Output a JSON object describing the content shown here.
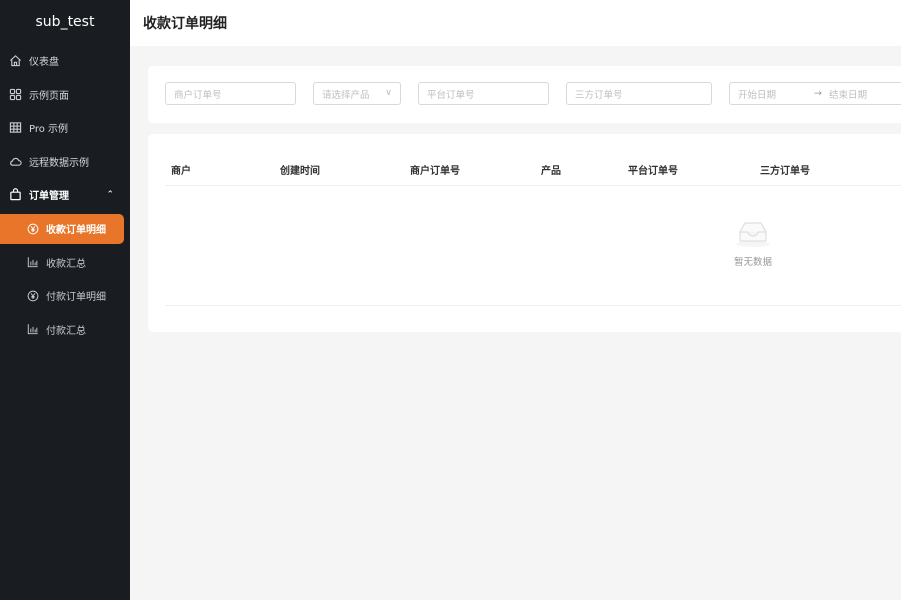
{
  "brand": {
    "title": "sub_test"
  },
  "sidebar": {
    "items": [
      {
        "label": "仪表盘",
        "icon": "home-icon"
      },
      {
        "label": "示例页面",
        "icon": "grid-icon"
      },
      {
        "label": "Pro 示例",
        "icon": "table-icon"
      },
      {
        "label": "远程数据示例",
        "icon": "cloud-icon"
      },
      {
        "label": "订单管理",
        "icon": "bag-icon",
        "expanded": true
      }
    ],
    "sub_items": [
      {
        "label": "收款订单明细",
        "icon": "yen-circle-icon",
        "active": true
      },
      {
        "label": "收款汇总",
        "icon": "bar-chart-icon"
      },
      {
        "label": "付款订单明细",
        "icon": "yen-circle-icon"
      },
      {
        "label": "付款汇总",
        "icon": "bar-chart-icon"
      }
    ],
    "active_color": "#e8752a",
    "bg_color": "#191c20"
  },
  "header": {
    "title": "收款订单明细"
  },
  "filters": {
    "merchant_order_placeholder": "商户订单号",
    "product_placeholder": "请选择产品",
    "platform_order_placeholder": "平台订单号",
    "third_party_order_placeholder": "三方订单号",
    "start_date_placeholder": "开始日期",
    "range_separator": "→",
    "end_date_placeholder": "结束日期"
  },
  "table": {
    "columns": [
      "商户",
      "创建时间",
      "商户订单号",
      "产品",
      "平台订单号",
      "三方订单号"
    ],
    "rows": [],
    "empty_text": "暂无数据"
  }
}
